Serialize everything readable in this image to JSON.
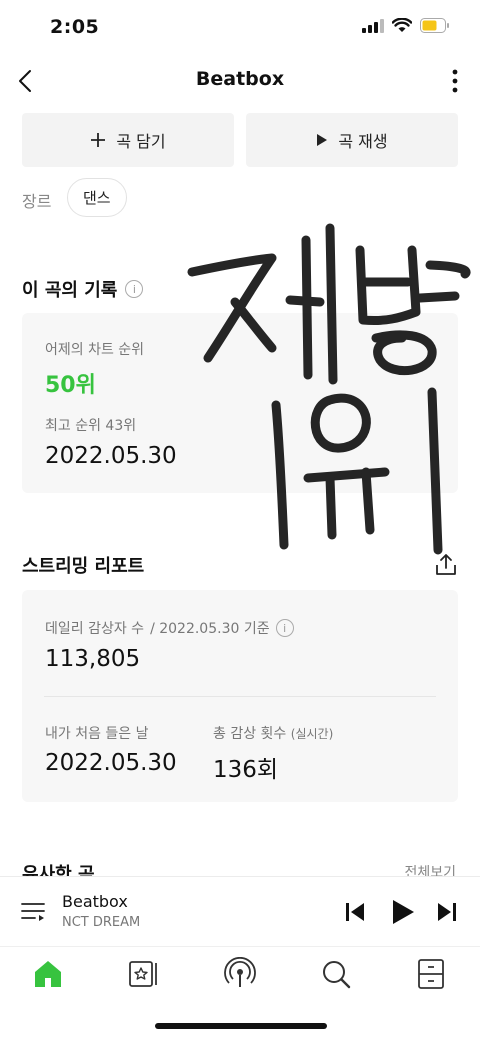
{
  "status_bar": {
    "time": "2:05"
  },
  "header": {
    "title": "Beatbox"
  },
  "actions": {
    "add_label": "곡 담기",
    "play_label": "곡 재생"
  },
  "genre": {
    "label": "장르",
    "value": "댄스"
  },
  "history": {
    "title": "이 곡의 기록",
    "yesterday_label": "어제의 차트 순위",
    "yesterday_rank": "50위",
    "best_label": "최고 순위 43위",
    "best_date": "2022.05.30"
  },
  "streaming": {
    "title": "스트리밍 리포트",
    "daily_label": "데일리 감상자 수",
    "daily_basis": "/ 2022.05.30 기준",
    "daily_value": "113,805",
    "first_listen_label": "내가 처음 들은 날",
    "first_listen_value": "2022.05.30",
    "total_label": "총 감상 횟수",
    "total_label_suffix": "(실시간)",
    "total_value": "136회"
  },
  "similar": {
    "title": "유사한 곡",
    "more_label": "전체보기"
  },
  "player": {
    "title": "Beatbox",
    "artist": "NCT DREAM"
  },
  "colors": {
    "accent": "#37c33f",
    "battery": "#f5c518"
  },
  "tabs": [
    "home-icon",
    "library-icon",
    "podcast-icon",
    "search-icon",
    "storage-icon"
  ]
}
